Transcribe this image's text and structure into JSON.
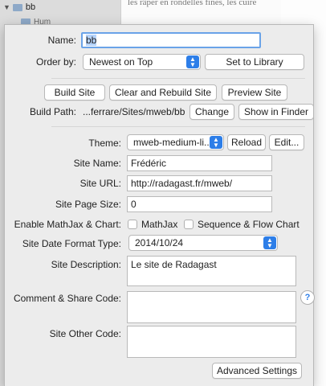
{
  "background": {
    "sidebar_item": "bb",
    "sidebar_subitem": "Hum",
    "doc_snippet": "les râper en rondelles fines,   les cuire"
  },
  "form": {
    "name_label": "Name:",
    "name_value": "bb",
    "order_label": "Order by:",
    "order_value": "Newest on Top",
    "set_library_button": "Set to Library",
    "build_site_button": "Build Site",
    "clear_rebuild_button": "Clear and Rebuild Site",
    "preview_site_button": "Preview Site",
    "build_path_label": "Build Path:",
    "build_path_value": "...ferrare/Sites/mweb/bb",
    "change_button": "Change",
    "show_finder_button": "Show in Finder",
    "theme_label": "Theme:",
    "theme_value": "mweb-medium-li...",
    "reload_button": "Reload",
    "edit_button": "Edit...",
    "site_name_label": "Site Name:",
    "site_name_value": "Frédéric",
    "site_url_label": "Site URL:",
    "site_url_value": "http://radagast.fr/mweb/",
    "page_size_label": "Site Page Size:",
    "page_size_value": "0",
    "mathjax_label": "Enable MathJax & Chart:",
    "mathjax_option": "MathJax",
    "sequence_option": "Sequence & Flow Chart",
    "date_format_label": "Site Date Format Type:",
    "date_format_value": "2014/10/24",
    "description_label": "Site Description:",
    "description_value": "Le site de Radagast",
    "comment_label": "Comment & Share Code:",
    "comment_value": "",
    "other_code_label": "Site Other Code:",
    "other_code_value": "",
    "help_symbol": "?",
    "advanced_button": "Advanced Settings"
  },
  "colors": {
    "accent": "#2d7ee8",
    "focus_ring": "#6aa3e8",
    "selection": "#b5d3fb"
  }
}
